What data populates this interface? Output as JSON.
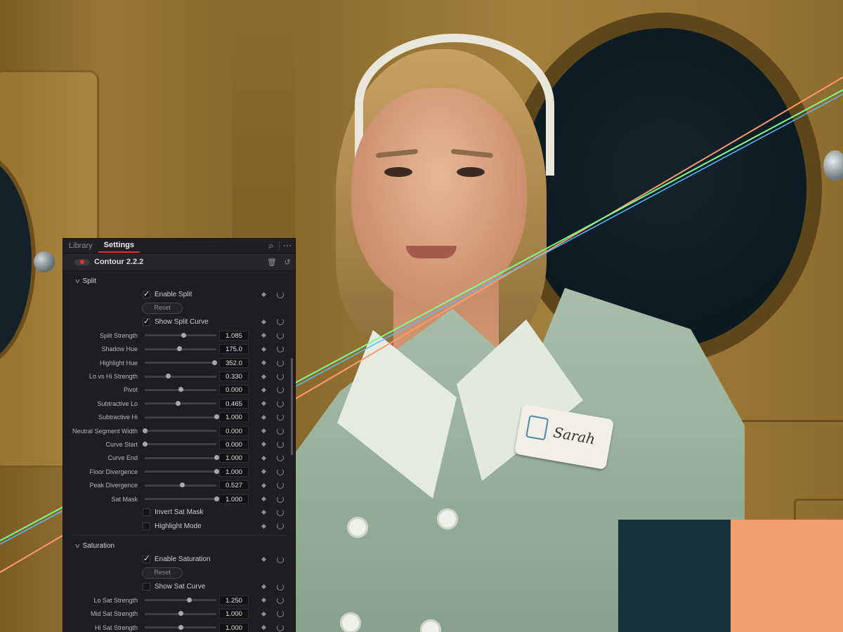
{
  "tabs": [
    "Library",
    "Settings"
  ],
  "active_tab": "Settings",
  "effect": {
    "name": "Contour 2.2.2",
    "enabled": true
  },
  "split": {
    "title": "Split",
    "enable_split": {
      "label": "Enable Split",
      "checked": true
    },
    "reset_label": "Reset",
    "show_split_curve": {
      "label": "Show Split Curve",
      "checked": true
    },
    "params": [
      {
        "label": "Split Strength",
        "value": "1.085",
        "fraction": 0.54
      },
      {
        "label": "Shadow Hue",
        "value": "175.0",
        "fraction": 0.49
      },
      {
        "label": "Highlight Hue",
        "value": "352.0",
        "fraction": 0.98
      },
      {
        "label": "Lo vs Hi Strength",
        "value": "0.330",
        "fraction": 0.33
      },
      {
        "label": "Pivot",
        "value": "0.000",
        "fraction": 0.5
      },
      {
        "label": "Subtractive Lo",
        "value": "0.465",
        "fraction": 0.465
      },
      {
        "label": "Subtractive Hi",
        "value": "1.000",
        "fraction": 1.0
      },
      {
        "label": "Neutral Segment Width",
        "value": "0.000",
        "fraction": 0.0
      },
      {
        "label": "Curve Start",
        "value": "0.000",
        "fraction": 0.0
      },
      {
        "label": "Curve End",
        "value": "1.000",
        "fraction": 1.0
      },
      {
        "label": "Floor Divergence",
        "value": "1.000",
        "fraction": 1.0
      },
      {
        "label": "Peak Divergence",
        "value": "0.527",
        "fraction": 0.527
      },
      {
        "label": "Sat Mask",
        "value": "1.000",
        "fraction": 1.0
      }
    ],
    "invert_sat_mask": {
      "label": "Invert Sat Mask",
      "checked": false
    },
    "highlight_mode": {
      "label": "Highlight Mode",
      "checked": false
    }
  },
  "saturation": {
    "title": "Saturation",
    "enable_saturation": {
      "label": "Enable Saturation",
      "checked": true
    },
    "reset_label": "Reset",
    "show_sat_curve": {
      "label": "Show Sat Curve",
      "checked": false
    },
    "params": [
      {
        "label": "Lo Sat Strength",
        "value": "1.250",
        "fraction": 0.625
      },
      {
        "label": "Mid Sat Strength",
        "value": "1.000",
        "fraction": 0.5
      },
      {
        "label": "Hi Sat Strength",
        "value": "1.000",
        "fraction": 0.5
      }
    ]
  },
  "nametag": "Sarah",
  "swatches": {
    "dark": "#17313b",
    "peach": "#f19e6f"
  },
  "waveform_colors": [
    "#ff9a6a",
    "#7cff8a",
    "#5ab8ff"
  ]
}
